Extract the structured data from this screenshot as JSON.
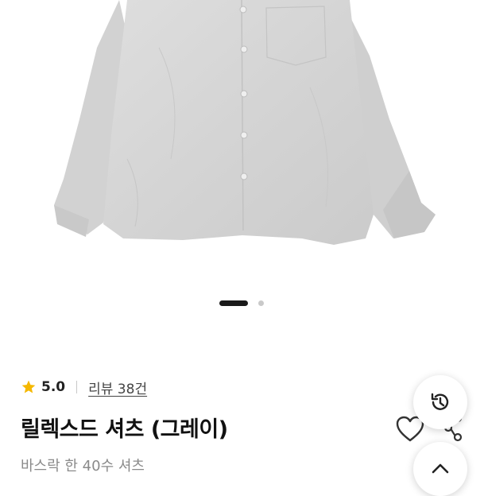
{
  "gallery": {
    "image_alt": "",
    "icon": "shirt-product-photo",
    "page_index": 1,
    "page_count": 2
  },
  "rating": {
    "icon": "star-icon",
    "value": "5.0",
    "star_color": "#F5B800"
  },
  "review": {
    "label": "리뷰 38건"
  },
  "product": {
    "title": "릴렉스드 셔츠 (그레이)",
    "subtitle": "바스락 한 40수 셔츠"
  },
  "actions": {
    "wishlist_icon": "heart-outline-icon",
    "share_icon": "share-icon",
    "history_icon": "history-icon",
    "scroll_top_icon": "chevron-up-icon"
  }
}
